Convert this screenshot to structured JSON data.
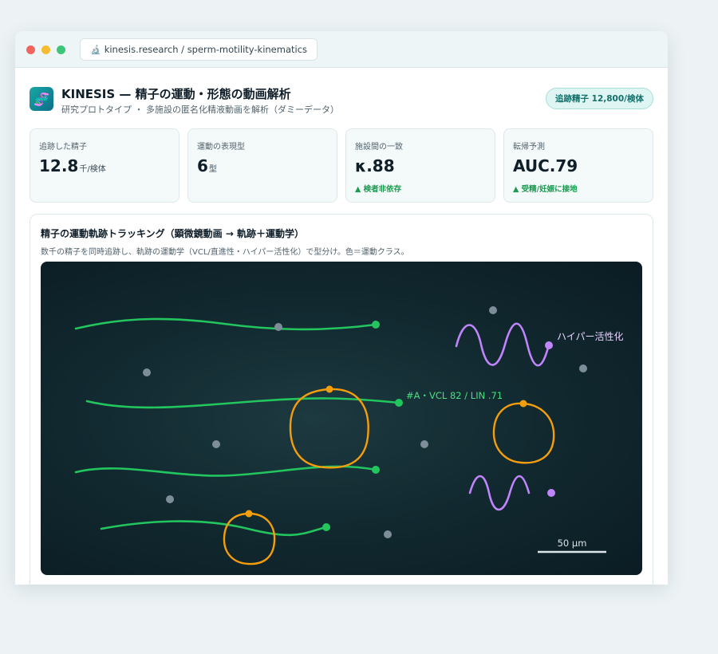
{
  "browser": {
    "url": "kinesis.research / sperm-motility-kinematics",
    "url_icon": "microscope-icon"
  },
  "header": {
    "logo_icon": "dna-icon",
    "title": "KINESIS — 精子の運動・形態の動画解析",
    "subtitle": "研究プロトタイプ ・ 多施設の匿名化精液動画を解析（ダミーデータ）",
    "badge": "追跡精子 12,800/検体"
  },
  "stats": [
    {
      "label": "追跡した精子",
      "value": "12.8",
      "unit": "千/検体",
      "note": ""
    },
    {
      "label": "運動の表現型",
      "value": "6",
      "unit": "型",
      "note": ""
    },
    {
      "label": "施設間の一致",
      "value": "κ.88",
      "unit": "",
      "note": "▲ 検者非依存"
    },
    {
      "label": "転帰予測",
      "value": "AUC.79",
      "unit": "",
      "note": "▲ 受精/妊娠に接地"
    }
  ],
  "panel": {
    "title": "精子の運動軌跡トラッキング（顕微鏡動画 → 軌跡＋運動学）",
    "description": "数千の精子を同時追跡し、軌跡の運動学（VCL/直進性・ハイパー活性化）で型分け。色＝運動クラス。",
    "viewer": {
      "track_label": "#A・VCL 82 / LIN .71",
      "hyper_label": "ハイパー活性化",
      "scale_label": "50 μm"
    }
  },
  "colors": {
    "progressive": "#22c55e",
    "circular": "#f59e0b",
    "hyperactivated": "#c084fc",
    "immotile": "#7d8e9a",
    "accent": "#1aa7a3"
  }
}
